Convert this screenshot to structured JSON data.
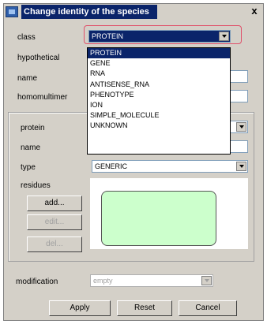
{
  "window": {
    "title": "Change identity of the species",
    "close_glyph": "x"
  },
  "species": {
    "class_label": "class",
    "class_value": "PROTEIN",
    "hypothetical_label": "hypothetical",
    "name_label": "name",
    "homomultimer_label": "homomultimer"
  },
  "class_dropdown": {
    "options": [
      "PROTEIN",
      "GENE",
      "RNA",
      "ANTISENSE_RNA",
      "PHENOTYPE",
      "ION",
      "SIMPLE_MOLECULE",
      "UNKNOWN"
    ],
    "selected": "PROTEIN"
  },
  "protein_panel": {
    "protein_label": "protein",
    "name_label": "name",
    "type_label": "type",
    "type_value": "GENERIC",
    "residues_label": "residues",
    "add_label": "add...",
    "edit_label": "edit...",
    "del_label": "del..."
  },
  "modification": {
    "label": "modification",
    "value": "empty"
  },
  "footer": {
    "apply_label": "Apply",
    "reset_label": "Reset",
    "cancel_label": "Cancel"
  },
  "colors": {
    "highlight_outline": "#e0506a",
    "residue_fill": "#ccffcc",
    "selection": "#0a246a"
  },
  "icons": {
    "title": "app-window-icon",
    "combo": "chevron-down-icon"
  }
}
